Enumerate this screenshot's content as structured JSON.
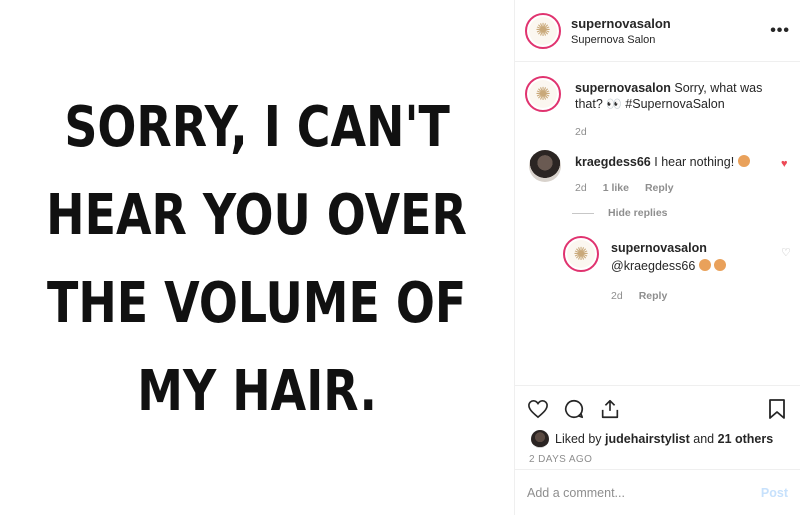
{
  "image": {
    "lines": [
      "SORRY, I CAN'T",
      "HEAR YOU OVER",
      "THE VOLUME OF",
      "MY HAIR."
    ]
  },
  "header": {
    "username": "supernovasalon",
    "subtitle": "Supernova Salon",
    "more_label": "•••"
  },
  "caption": {
    "username": "supernovasalon",
    "text": "Sorry, what was that? 👀 #SupernovaSalon",
    "age": "2d"
  },
  "comments": [
    {
      "username": "kraegdess66",
      "text": "I hear nothing!",
      "emoji": "face",
      "age": "2d",
      "likes": "1 like",
      "reply_label": "Reply",
      "liked": true
    }
  ],
  "hide_replies_label": "Hide replies",
  "reply": {
    "username": "supernovasalon",
    "text": "@kraegdess66",
    "age": "2d",
    "reply_label": "Reply"
  },
  "likes": {
    "prefix": "Liked by",
    "user": "judehairstylist",
    "connector": "and",
    "others": "21 others"
  },
  "timestamp": "2 DAYS AGO",
  "add_comment": {
    "placeholder": "Add a comment...",
    "post_label": "Post"
  },
  "colors": {
    "story_ring": "#e0336f",
    "liked_heart": "#ed4956",
    "post_button_disabled": "#c7e1fc"
  }
}
